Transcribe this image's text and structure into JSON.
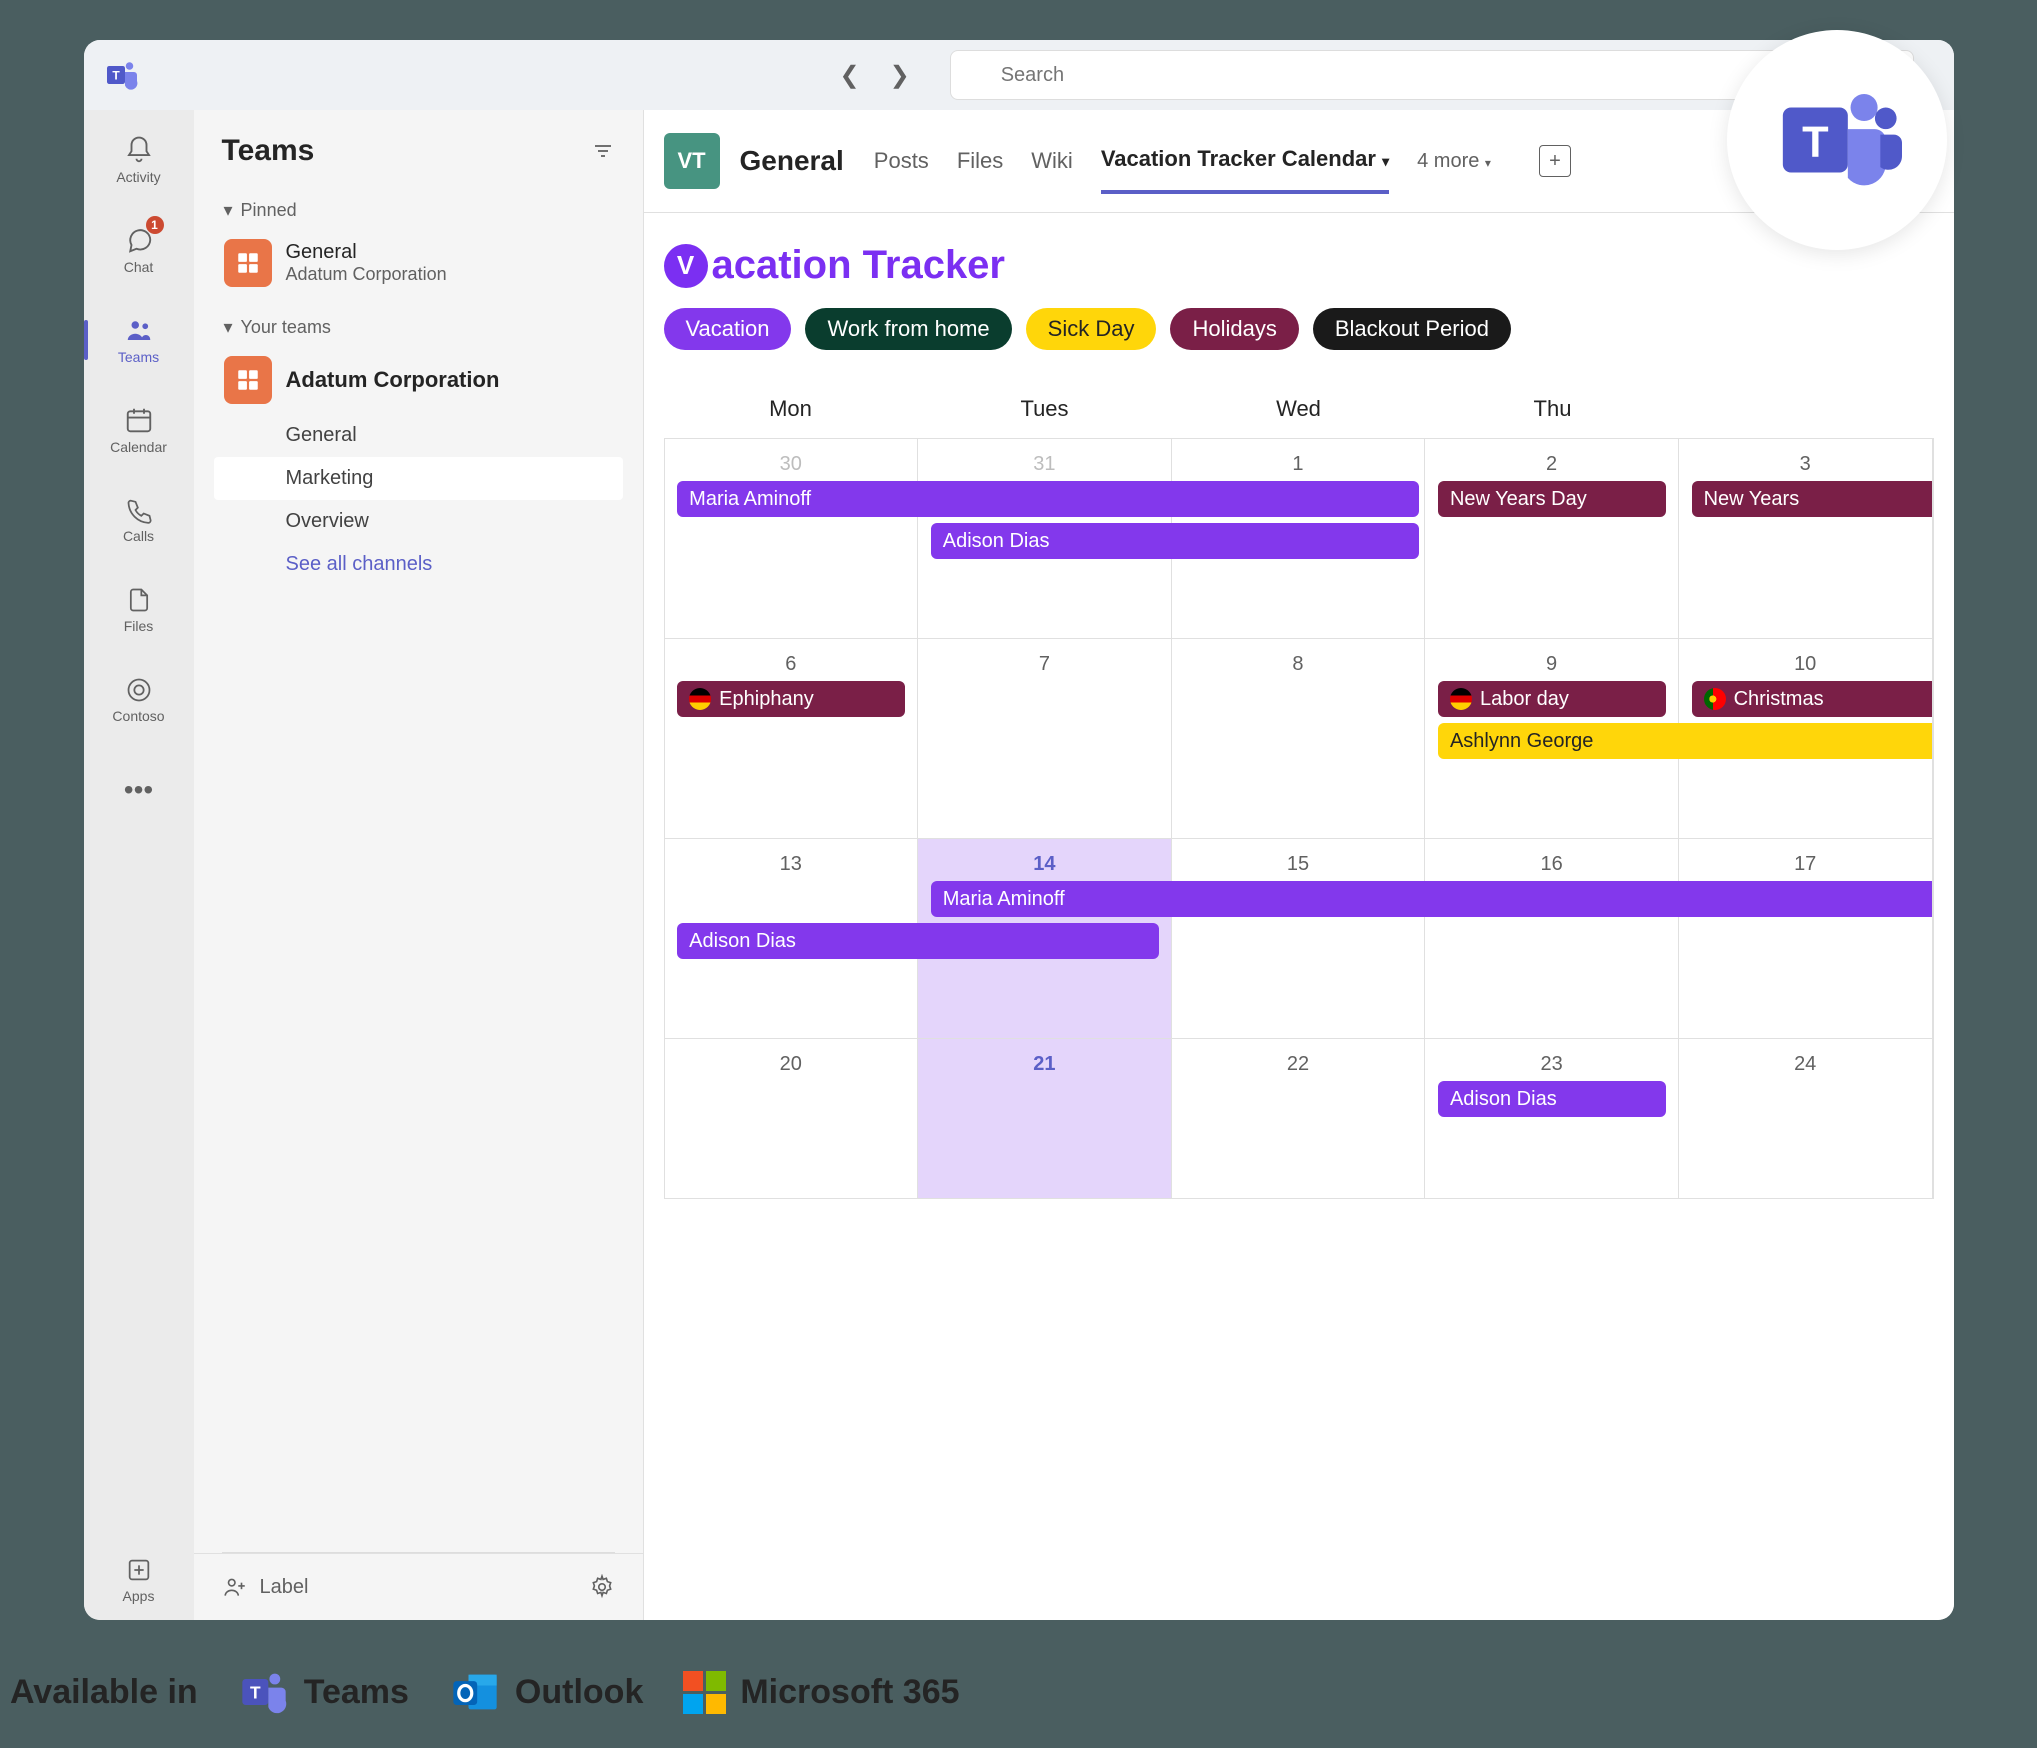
{
  "search": {
    "placeholder": "Search"
  },
  "rail": {
    "activity": "Activity",
    "chat": "Chat",
    "chat_badge": "1",
    "teams": "Teams",
    "calendar": "Calendar",
    "calls": "Calls",
    "files": "Files",
    "contoso": "Contoso",
    "apps": "Apps"
  },
  "sidebar": {
    "title": "Teams",
    "pinned": "Pinned",
    "general_name": "General",
    "general_sub": "Adatum Corporation",
    "your_teams": "Your teams",
    "adatum": "Adatum Corporation",
    "channels": {
      "general": "General",
      "marketing": "Marketing",
      "overview": "Overview"
    },
    "see_all": "See all channels",
    "footer_label": "Label"
  },
  "channel": {
    "avatar": "VT",
    "name": "General",
    "tabs": {
      "posts": "Posts",
      "files": "Files",
      "wiki": "Wiki",
      "active": "Vacation Tracker Calendar"
    },
    "more": "4 more"
  },
  "vt": {
    "title": "acation Tracker",
    "legend": {
      "vacation": "Vacation",
      "wfh": "Work from home",
      "sick": "Sick Day",
      "holidays": "Holidays",
      "blackout": "Blackout Period"
    }
  },
  "calendar": {
    "days": [
      "Mon",
      "Tues",
      "Wed",
      "Thu",
      ""
    ],
    "weeks": [
      {
        "nums": [
          "30",
          "31",
          "1",
          "2",
          "3"
        ],
        "muted": [
          0,
          1
        ]
      },
      {
        "nums": [
          "6",
          "7",
          "8",
          "9",
          "10"
        ]
      },
      {
        "nums": [
          "13",
          "14",
          "15",
          "16",
          "17"
        ],
        "today": 1
      },
      {
        "nums": [
          "20",
          "21",
          "22",
          "23",
          "24"
        ],
        "today": 1
      }
    ],
    "events": {
      "w0": {
        "maria": "Maria Aminoff",
        "adison": "Adison Dias",
        "nyd": "New Years Day",
        "ny": "New Years"
      },
      "w1": {
        "eph": "Ephiphany",
        "labor": "Labor day",
        "christmas": "Christmas",
        "ashlynn": "Ashlynn George"
      },
      "w2": {
        "maria": "Maria Aminoff",
        "adison": "Adison Dias"
      },
      "w3": {
        "adison": "Adison Dias"
      }
    }
  },
  "footer": {
    "available": "Available in",
    "teams": "Teams",
    "outlook": "Outlook",
    "m365": "Microsoft 365"
  }
}
